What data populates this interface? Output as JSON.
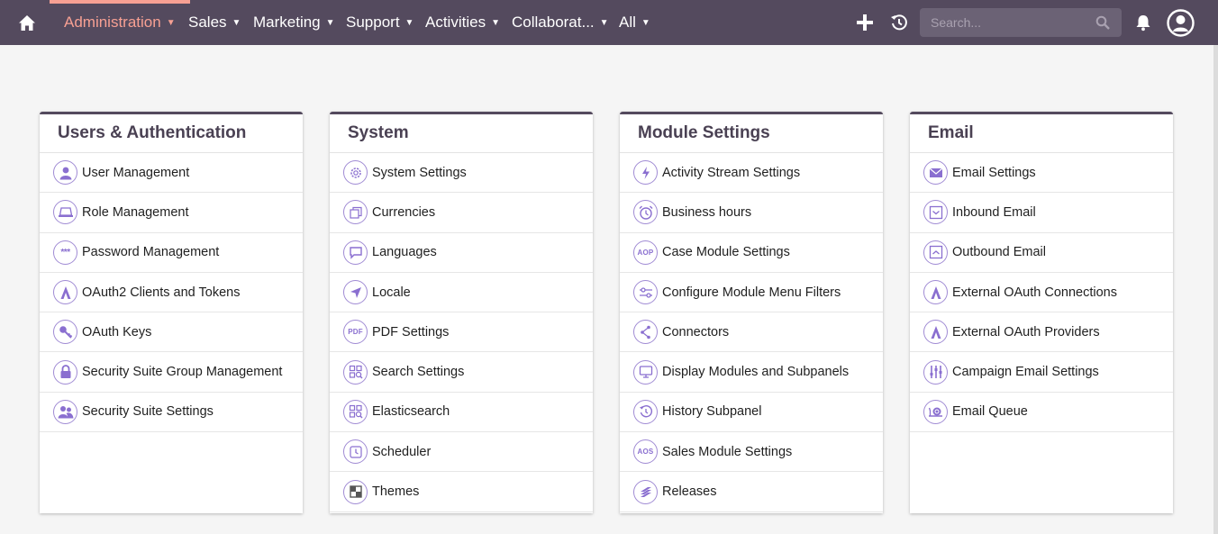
{
  "nav": {
    "items": [
      {
        "label": "Administration",
        "active": true
      },
      {
        "label": "Sales"
      },
      {
        "label": "Marketing"
      },
      {
        "label": "Support"
      },
      {
        "label": "Activities"
      },
      {
        "label": "Collaborat..."
      },
      {
        "label": "All"
      }
    ],
    "search_placeholder": "Search...",
    "colors": {
      "bar": "#544a5e",
      "active": "#f7a093",
      "icon": "#8a6fd0"
    }
  },
  "panels": [
    {
      "title": "Users & Authentication",
      "items": [
        {
          "label": "User Management",
          "icon": "user-icon"
        },
        {
          "label": "Role Management",
          "icon": "laptop-icon"
        },
        {
          "label": "Password Management",
          "icon": "password-icon"
        },
        {
          "label": "OAuth2 Clients and Tokens",
          "icon": "oauth-icon"
        },
        {
          "label": "OAuth Keys",
          "icon": "key-icon"
        },
        {
          "label": "Security Suite Group Management",
          "icon": "lock-icon"
        },
        {
          "label": "Security Suite Settings",
          "icon": "users-icon"
        }
      ]
    },
    {
      "title": "System",
      "items": [
        {
          "label": "System Settings",
          "icon": "gear-icon"
        },
        {
          "label": "Currencies",
          "icon": "currency-icon"
        },
        {
          "label": "Languages",
          "icon": "speech-bubble-icon"
        },
        {
          "label": "Locale",
          "icon": "location-arrow-icon"
        },
        {
          "label": "PDF Settings",
          "icon": "pdf-icon",
          "icon_text": "PDF"
        },
        {
          "label": "Search Settings",
          "icon": "search-settings-icon"
        },
        {
          "label": "Elasticsearch",
          "icon": "elasticsearch-icon"
        },
        {
          "label": "Scheduler",
          "icon": "clock-icon"
        },
        {
          "label": "Themes",
          "icon": "themes-icon"
        }
      ]
    },
    {
      "title": "Module Settings",
      "items": [
        {
          "label": "Activity Stream Settings",
          "icon": "lightning-icon"
        },
        {
          "label": "Business hours",
          "icon": "alarm-clock-icon"
        },
        {
          "label": "Case Module Settings",
          "icon": "aop-icon",
          "icon_text": "AOP"
        },
        {
          "label": "Configure Module Menu Filters",
          "icon": "sliders-icon"
        },
        {
          "label": "Connectors",
          "icon": "connectors-icon"
        },
        {
          "label": "Display Modules and Subpanels",
          "icon": "monitor-icon"
        },
        {
          "label": "History Subpanel",
          "icon": "history-icon"
        },
        {
          "label": "Sales Module Settings",
          "icon": "aos-icon",
          "icon_text": "AOS"
        },
        {
          "label": "Releases",
          "icon": "layers-icon"
        }
      ]
    },
    {
      "title": "Email",
      "items": [
        {
          "label": "Email Settings",
          "icon": "envelope-icon"
        },
        {
          "label": "Inbound Email",
          "icon": "inbox-icon"
        },
        {
          "label": "Outbound Email",
          "icon": "outbox-icon"
        },
        {
          "label": "External OAuth Connections",
          "icon": "oauth-icon"
        },
        {
          "label": "External OAuth Providers",
          "icon": "oauth-icon"
        },
        {
          "label": "Campaign Email Settings",
          "icon": "equalizer-icon"
        },
        {
          "label": "Email Queue",
          "icon": "snail-icon"
        }
      ]
    }
  ]
}
